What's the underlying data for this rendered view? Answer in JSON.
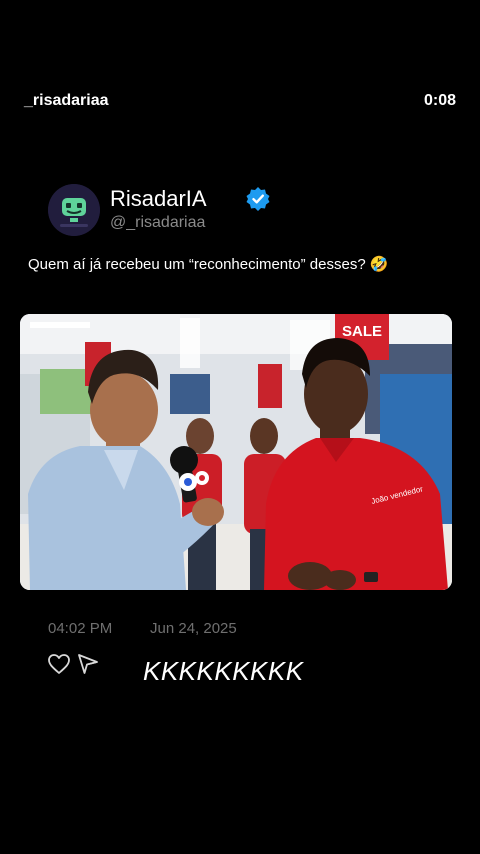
{
  "header": {
    "username": "_risadariaa",
    "timestamp": "0:08"
  },
  "post": {
    "author_name": "RisadarIA",
    "author_handle": "@_risadariaa",
    "verified_icon": "verified-badge-icon",
    "text": "Quem aí já recebeu um “reconhecimento” desses? 🤣",
    "time": "04:02 PM",
    "date": "Jun 24, 2025",
    "store_sign": "SALE",
    "shirt_text": "João vendedor"
  },
  "actions": {
    "like_icon": "heart-icon",
    "share_icon": "send-icon"
  },
  "caption": "KKKKKKKKK",
  "colors": {
    "background": "#000000",
    "verified": "#1d9bf0",
    "shirt_red": "#d4141f"
  }
}
